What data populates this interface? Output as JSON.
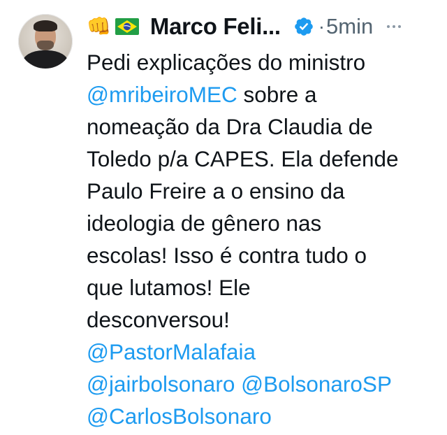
{
  "author": {
    "emoji": "👊",
    "name": "Marco Feli...",
    "time": "5min",
    "separator": "·"
  },
  "colors": {
    "text": "#0f1419",
    "muted": "#536471",
    "link": "#1d9bf0",
    "verified": "#1d9bf0"
  },
  "icons": {
    "avatar": "profile-photo",
    "emoji": "fist-emoji",
    "flag": "brazil-flag-icon",
    "verified": "verified-badge-icon",
    "more": "more-options-icon"
  },
  "tweet": {
    "lines": [
      {
        "text": "Pedi explicações do ministro",
        "mention": ""
      },
      {
        "text": " sobre a",
        "mention": "@mribeiroMEC"
      },
      {
        "text": "nomeação da Dra Claudia de",
        "mention": ""
      },
      {
        "text": "Toledo p/a CAPES. Ela defende",
        "mention": ""
      },
      {
        "text": "Paulo Freire a o ensino da",
        "mention": ""
      },
      {
        "text": "ideologia de gênero nas",
        "mention": ""
      },
      {
        "text": "escolas! Isso é contra tudo o",
        "mention": ""
      },
      {
        "text": "que lutamos! Ele",
        "mention": ""
      },
      {
        "text": "desconversou!",
        "mention": ""
      }
    ],
    "mentions": [
      "@PastorMalafaia",
      "@jairbolsonaro",
      "@BolsonaroSP",
      "@CarlosBolsonaro"
    ]
  }
}
